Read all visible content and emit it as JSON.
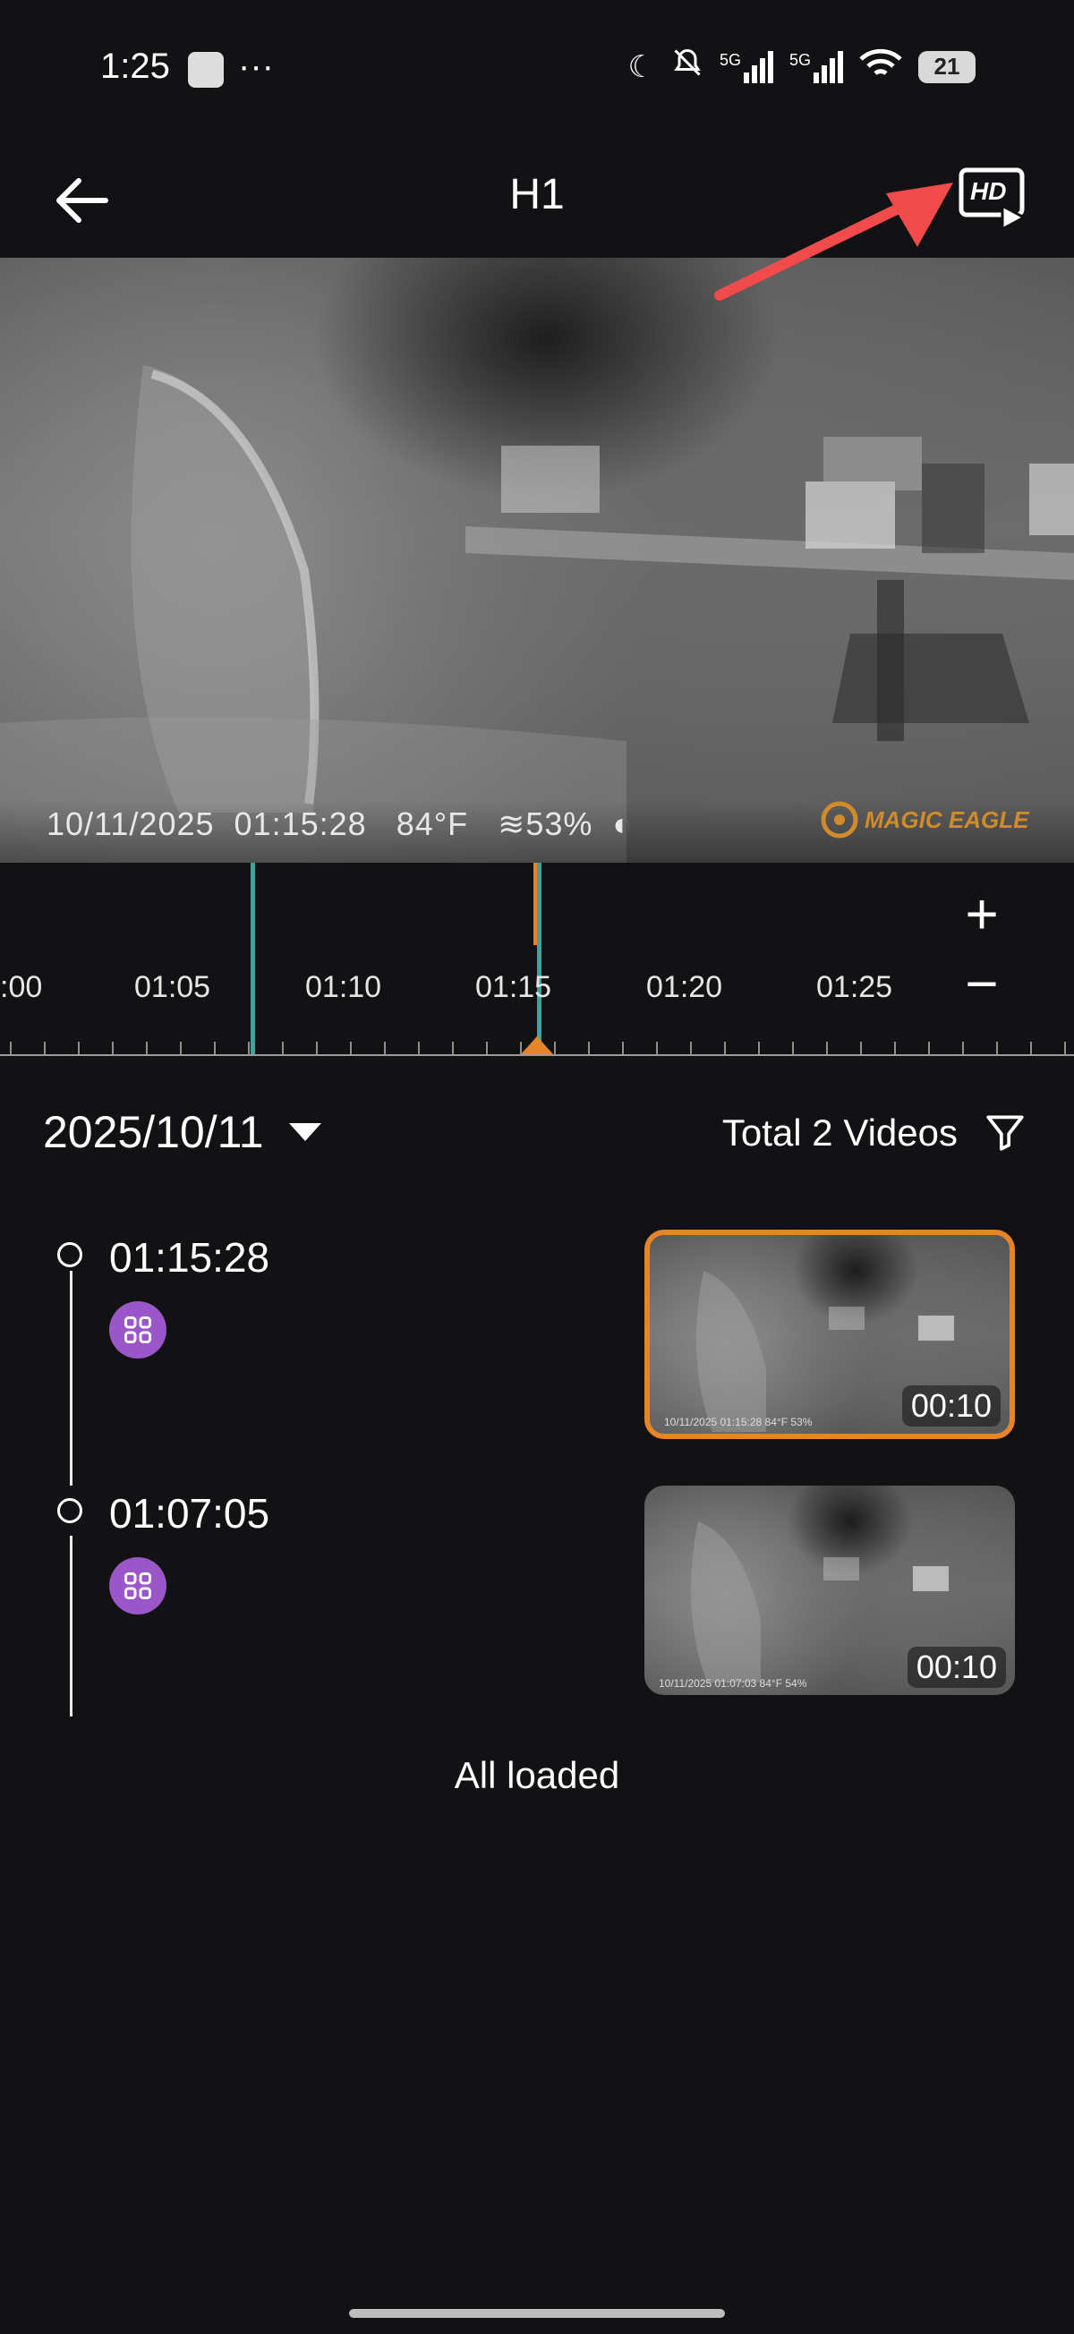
{
  "status_bar": {
    "time": "1:25",
    "signal_1": "5G",
    "signal_2": "5G",
    "battery": "21"
  },
  "header": {
    "title": "H1",
    "back_icon": "arrow-left-icon",
    "hd_icon": "hd-playback-icon",
    "hd_label": "HD"
  },
  "video": {
    "overlay_date": "10/11/2025",
    "overlay_time": "01:15:28",
    "overlay_temp": "84°F",
    "overlay_humidity": "53%",
    "brand": "MAGIC EAGLE"
  },
  "timeline": {
    "labels": [
      ":00",
      "01:05",
      "01:10",
      "01:15",
      "01:20",
      "01:25"
    ],
    "zoom_in": "+",
    "zoom_out": "−",
    "accent": "#e6842a",
    "marker_color": "#3aa59a"
  },
  "list_header": {
    "date": "2025/10/11",
    "total": "Total 2 Videos"
  },
  "events": [
    {
      "time": "01:15:28",
      "duration": "00:10",
      "thumb_osd": "10/11/2025  01:15:28   84°F  53%",
      "selected": true
    },
    {
      "time": "01:07:05",
      "duration": "00:10",
      "thumb_osd": "10/11/2025  01:07:03   84°F  54%",
      "selected": false
    }
  ],
  "footer": {
    "all_loaded": "All loaded"
  },
  "colors": {
    "background": "#121214",
    "purple_badge": "#9b56c9",
    "selected_border": "#e6842a",
    "annotation_arrow": "#f04a4a"
  }
}
